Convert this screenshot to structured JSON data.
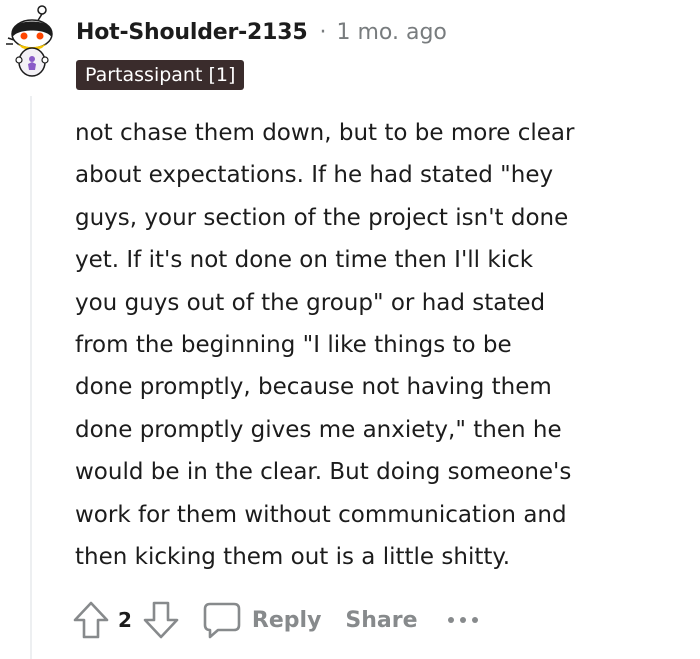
{
  "comment": {
    "author": "Hot-Shoulder-2135",
    "separator": "·",
    "age": "1 mo. ago",
    "flair": "Partassipant [1]",
    "body_lines": [
      "not chase them down, but to be more clear",
      "about expectations. If he had stated \"hey",
      "guys, your section of the project isn't done",
      "yet. If it's not done on time then I'll kick",
      "you guys out of the group\" or had stated",
      "from the beginning \"I like things to be",
      "done promptly, because not having them",
      "done promptly gives me anxiety,\" then he",
      "would be in the clear. But doing someone's",
      "work for them without communication and",
      "then kicking them out is a little shitty."
    ]
  },
  "actions": {
    "score": "2",
    "reply_label": "Reply",
    "share_label": "Share",
    "upvote_icon": "arrow-up-icon",
    "downvote_icon": "arrow-down-icon",
    "reply_icon": "speech-bubble-icon",
    "more_icon": "ellipsis-icon"
  },
  "colors": {
    "flair_bg": "#3a2c2c",
    "meta_gray": "#787c7e",
    "action_gray": "#878a8c",
    "thread_line": "#edeff1"
  }
}
